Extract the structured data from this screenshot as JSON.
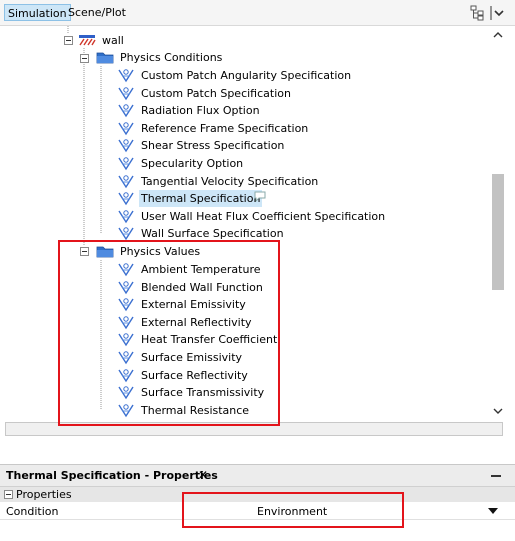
{
  "tabs": {
    "simulation": "Simulation",
    "scene_plot": "Scene/Plot"
  },
  "tree": {
    "wall": "wall",
    "physics_conditions": {
      "label": "Physics Conditions",
      "items": [
        "Custom Patch Angularity Specification",
        "Custom Patch Specification",
        "Radiation Flux Option",
        "Reference Frame Specification",
        "Shear Stress Specification",
        "Specularity Option",
        "Tangential Velocity Specification",
        "Thermal Specification",
        "User Wall Heat Flux Coefficient Specification",
        "Wall Surface Specification"
      ]
    },
    "physics_values": {
      "label": "Physics Values",
      "items": [
        "Ambient Temperature",
        "Blended Wall Function",
        "External Emissivity",
        "External Reflectivity",
        "Heat Transfer Coefficient",
        "Surface Emissivity",
        "Surface Reflectivity",
        "Surface Transmissivity",
        "Thermal Resistance"
      ]
    }
  },
  "properties": {
    "title": "Thermal Specification - Properties",
    "close": "✕",
    "group": "Properties",
    "rows": [
      {
        "name": "Condition",
        "value": "Environment"
      }
    ]
  },
  "colors": {
    "selection": "#cde6f7",
    "folder": "#2f6ec8",
    "highlight": "#e3141b",
    "scroll_thumb": "#c2c2c2"
  },
  "icons": {
    "item": "physics-setting-icon",
    "folder": "folder-icon",
    "wall": "wall-boundary-icon",
    "tree_view": "tree-view-icon",
    "menu": "panel-menu-icon"
  }
}
